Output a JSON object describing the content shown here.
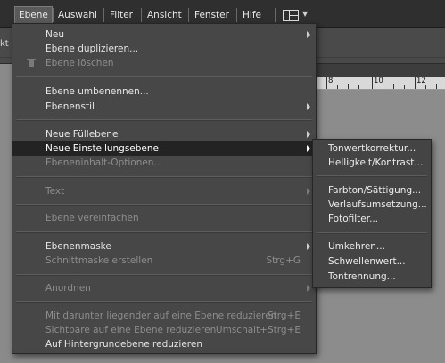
{
  "menubar": {
    "items": [
      {
        "label": "Ebene"
      },
      {
        "label": "Auswahl"
      },
      {
        "label": "Filter"
      },
      {
        "label": "Ansicht"
      },
      {
        "label": "Fenster"
      },
      {
        "label": "Hife"
      }
    ]
  },
  "options_bar": {
    "partial_text": "kt"
  },
  "ruler": {
    "labels": [
      "8",
      "10",
      "12"
    ]
  },
  "layer_menu": {
    "items": [
      {
        "label": "Neu",
        "submenu": true,
        "enabled": true
      },
      {
        "label": "Ebene duplizieren...",
        "enabled": true
      },
      {
        "label": "Ebene löschen",
        "enabled": false,
        "icon": "trash-icon"
      },
      {
        "label": "Ebene umbenennen...",
        "enabled": true
      },
      {
        "label": "Ebenenstil",
        "submenu": true,
        "enabled": true
      },
      {
        "label": "Neue Füllebene",
        "submenu": true,
        "enabled": true
      },
      {
        "label": "Neue Einstellungsebene",
        "submenu": true,
        "enabled": true,
        "highlighted": true
      },
      {
        "label": "Ebeneninhalt-Optionen...",
        "enabled": false
      },
      {
        "label": "Text",
        "submenu": true,
        "enabled": false
      },
      {
        "label": "Ebene vereinfachen",
        "enabled": false
      },
      {
        "label": "Ebenenmaske",
        "submenu": true,
        "enabled": true
      },
      {
        "label": "Schnittmaske erstellen",
        "shortcut": "Strg+G",
        "enabled": false
      },
      {
        "label": "Anordnen",
        "submenu": true,
        "enabled": false
      },
      {
        "label": "Mit darunter liegender auf eine Ebene reduzieren",
        "shortcut": "Strg+E",
        "enabled": false
      },
      {
        "label": "Sichtbare auf eine Ebene reduzieren",
        "shortcut": "Umschalt+Strg+E",
        "enabled": false
      },
      {
        "label": "Auf Hintergrundebene reduzieren",
        "enabled": true
      }
    ]
  },
  "adjustment_submenu": {
    "items": [
      {
        "label": "Tonwertkorrektur..."
      },
      {
        "label": "Helligkeit/Kontrast..."
      },
      {
        "label": "Farbton/Sättigung..."
      },
      {
        "label": "Verlaufsumsetzung..."
      },
      {
        "label": "Fotofilter..."
      },
      {
        "label": "Umkehren..."
      },
      {
        "label": "Schwellenwert..."
      },
      {
        "label": "Tontrennung..."
      }
    ]
  }
}
